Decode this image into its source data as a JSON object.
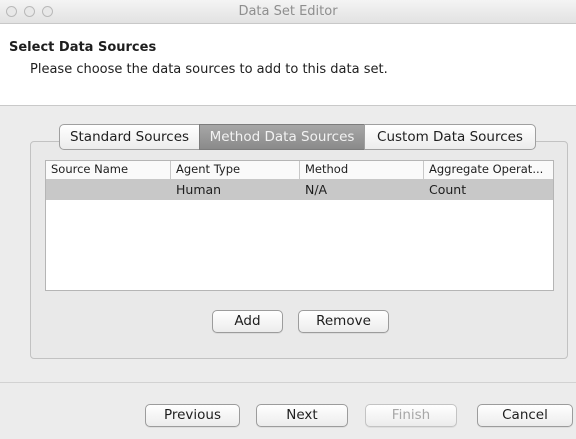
{
  "window": {
    "title": "Data Set Editor"
  },
  "header": {
    "title": "Select Data Sources",
    "description": "Please choose the data sources to add to this data set."
  },
  "tabs": [
    {
      "label": "Standard Sources",
      "active": false
    },
    {
      "label": "Method Data Sources",
      "active": true
    },
    {
      "label": "Custom Data Sources",
      "active": false
    }
  ],
  "table": {
    "columns": [
      "Source Name",
      "Agent Type",
      "Method",
      "Aggregate Operat..."
    ],
    "rows": [
      {
        "source_name": "",
        "agent_type": "Human",
        "method": "N/A",
        "aggregate_operation": "Count"
      }
    ]
  },
  "actions": {
    "add": "Add",
    "remove": "Remove"
  },
  "footer": {
    "previous": "Previous",
    "next": "Next",
    "finish": "Finish",
    "cancel": "Cancel"
  },
  "colors": {
    "selected_row": "#c8c8c8",
    "active_tab": "#8a8a8a"
  }
}
